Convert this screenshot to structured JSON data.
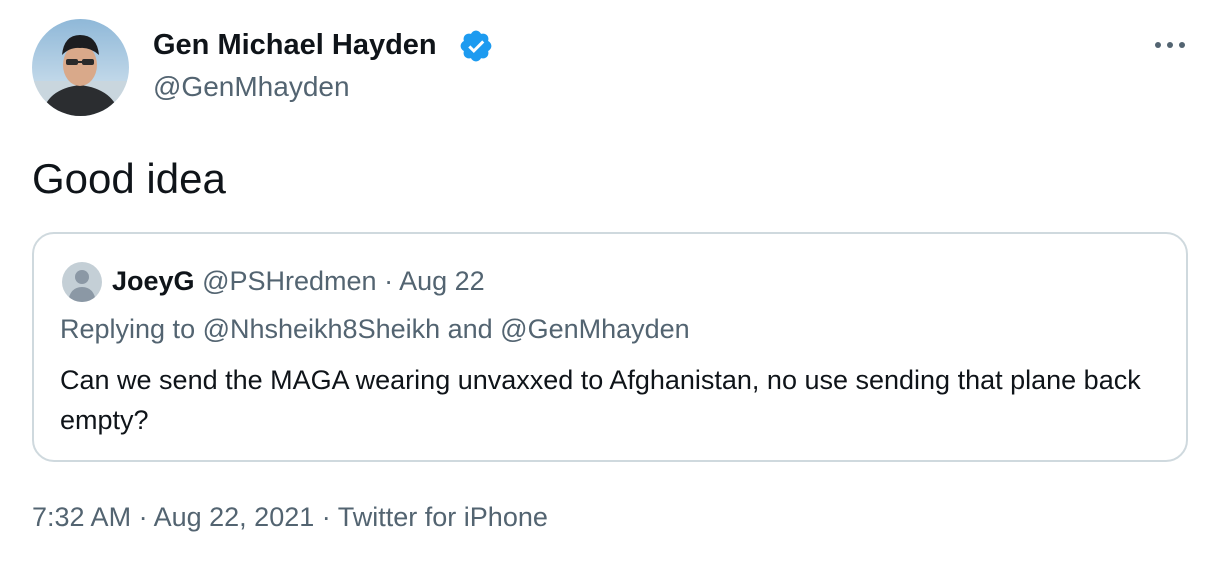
{
  "tweet": {
    "author": {
      "name": "Gen Michael Hayden",
      "handle": "@GenMhayden",
      "verified": true
    },
    "text": "Good idea",
    "quoted": {
      "name": "JoeyG",
      "handle": "@PSHredmen",
      "separator": "·",
      "date": "Aug 22",
      "replying_to": "Replying to @Nhsheikh8Sheikh and @GenMhayden",
      "text": "Can we send the MAGA wearing unvaxxed to Afghanistan, no use sending that plane back empty?"
    },
    "footer": {
      "time": "7:32 AM",
      "separator": "·",
      "date": "Aug 22, 2021",
      "source": "Twitter for iPhone"
    }
  },
  "colors": {
    "text": "#0f1419",
    "secondary": "#536471",
    "verified": "#1d9bf0",
    "border": "#cfd9de"
  },
  "icons": {
    "verified": "verified-badge-icon",
    "more": "more-horizontal-icon",
    "avatar": "user-avatar",
    "quoted_avatar": "default-avatar-icon"
  }
}
